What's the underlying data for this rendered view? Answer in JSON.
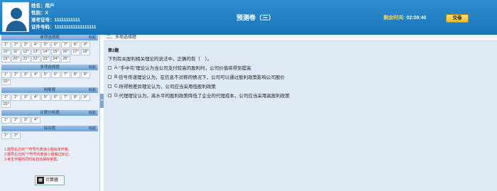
{
  "header": {
    "user": {
      "name_label": "姓名：",
      "name": "用户",
      "gender_label": "性别：",
      "gender": "X",
      "exam_no_label": "准考证号：",
      "exam_no": "11111111111",
      "id_label": "证件号码：",
      "id_no": "111111111111111111"
    },
    "title": "预测卷（三）",
    "timer_label": "剩余时间:",
    "timer_value": "02:09:40",
    "submit_label": "交卷"
  },
  "sidebar": {
    "collapse_label": "收起",
    "sections": [
      {
        "title": "单项选择题",
        "items": [
          "1°",
          "2°",
          "3°",
          "4°",
          "5°",
          "6°",
          "7°",
          "8°",
          "9°",
          "10°",
          "11°",
          "12°",
          "13°",
          "14°",
          "15°",
          "16°",
          "17°",
          "18°",
          "19°",
          "20°",
          "21°",
          "22°",
          "23°",
          "24°",
          "25°"
        ]
      },
      {
        "title": "多项选择题",
        "items": [
          "1°",
          "2°",
          "3°",
          "4°",
          "5°",
          "6°",
          "7°",
          "8°",
          "9°",
          "10°"
        ]
      },
      {
        "title": "判断题",
        "items": [
          "1°",
          "2°",
          "3°",
          "4°",
          "5°",
          "6°",
          "7°",
          "8°",
          "9°",
          "10°"
        ]
      },
      {
        "title": "计算分析题",
        "items": [
          "1°",
          "2°",
          "3°",
          "4°"
        ]
      },
      {
        "title": "综合题",
        "items": [
          "1°",
          "2°"
        ]
      }
    ],
    "notes": [
      "1.题号右方的\"°\"符号代表该小题尚未作答。",
      "2.题号右方的\"?\"符号代表该小题做过标记。",
      "3.考生作答的同时会自动保存答案。"
    ],
    "calculator_label": "计算器"
  },
  "content": {
    "section_title": "二、多项选择题",
    "question_number": "第2题",
    "question_text": "下列有关股利相关理论的说法中，正确的有（　）。",
    "options": [
      {
        "letter": "A.",
        "text": "\"手中鸟\"理论认为当公司支付较高的股利时，公司价值将得到提高"
      },
      {
        "letter": "B.",
        "text": "信号传递理论认为，在信息不对称的情况下，公司可以通过股利政策影响公司股价"
      },
      {
        "letter": "C.",
        "text": "所得税差异理论认为，公司应当采用低股利政策"
      },
      {
        "letter": "D.",
        "text": "代理理论认为，高水平的股利政策降低了企业的代理成本，公司应当采用高股利政策"
      }
    ]
  }
}
